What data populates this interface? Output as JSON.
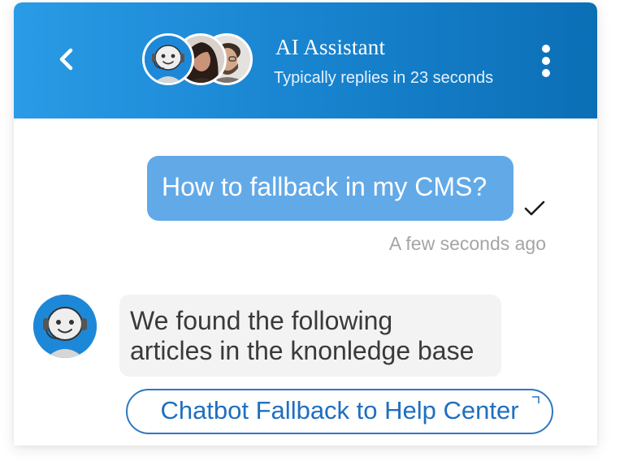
{
  "header": {
    "title": "AI Assistant",
    "subtitle": "Typically replies in 23 seconds",
    "gradient_colors": [
      "#2a9be6",
      "#0b6fb6"
    ],
    "avatars": [
      "bot-avatar",
      "woman-avatar",
      "man-avatar"
    ],
    "back_icon": "chevron-left-icon",
    "menu_icon": "vertical-dots-icon"
  },
  "messages": {
    "user": {
      "text": "How to fallback in my CMS?",
      "status_icon": "checkmark-icon",
      "timestamp": "A few seconds ago",
      "bubble_color": "#62a9e8"
    },
    "bot": {
      "line1": "We found the following",
      "line2": "articles in the knonledge base",
      "link_label": "Chatbot Fallback to Help Center",
      "link_icon": "external-link-icon",
      "bubble_color": "#f3f3f3",
      "link_color": "#1f6fbf"
    }
  }
}
